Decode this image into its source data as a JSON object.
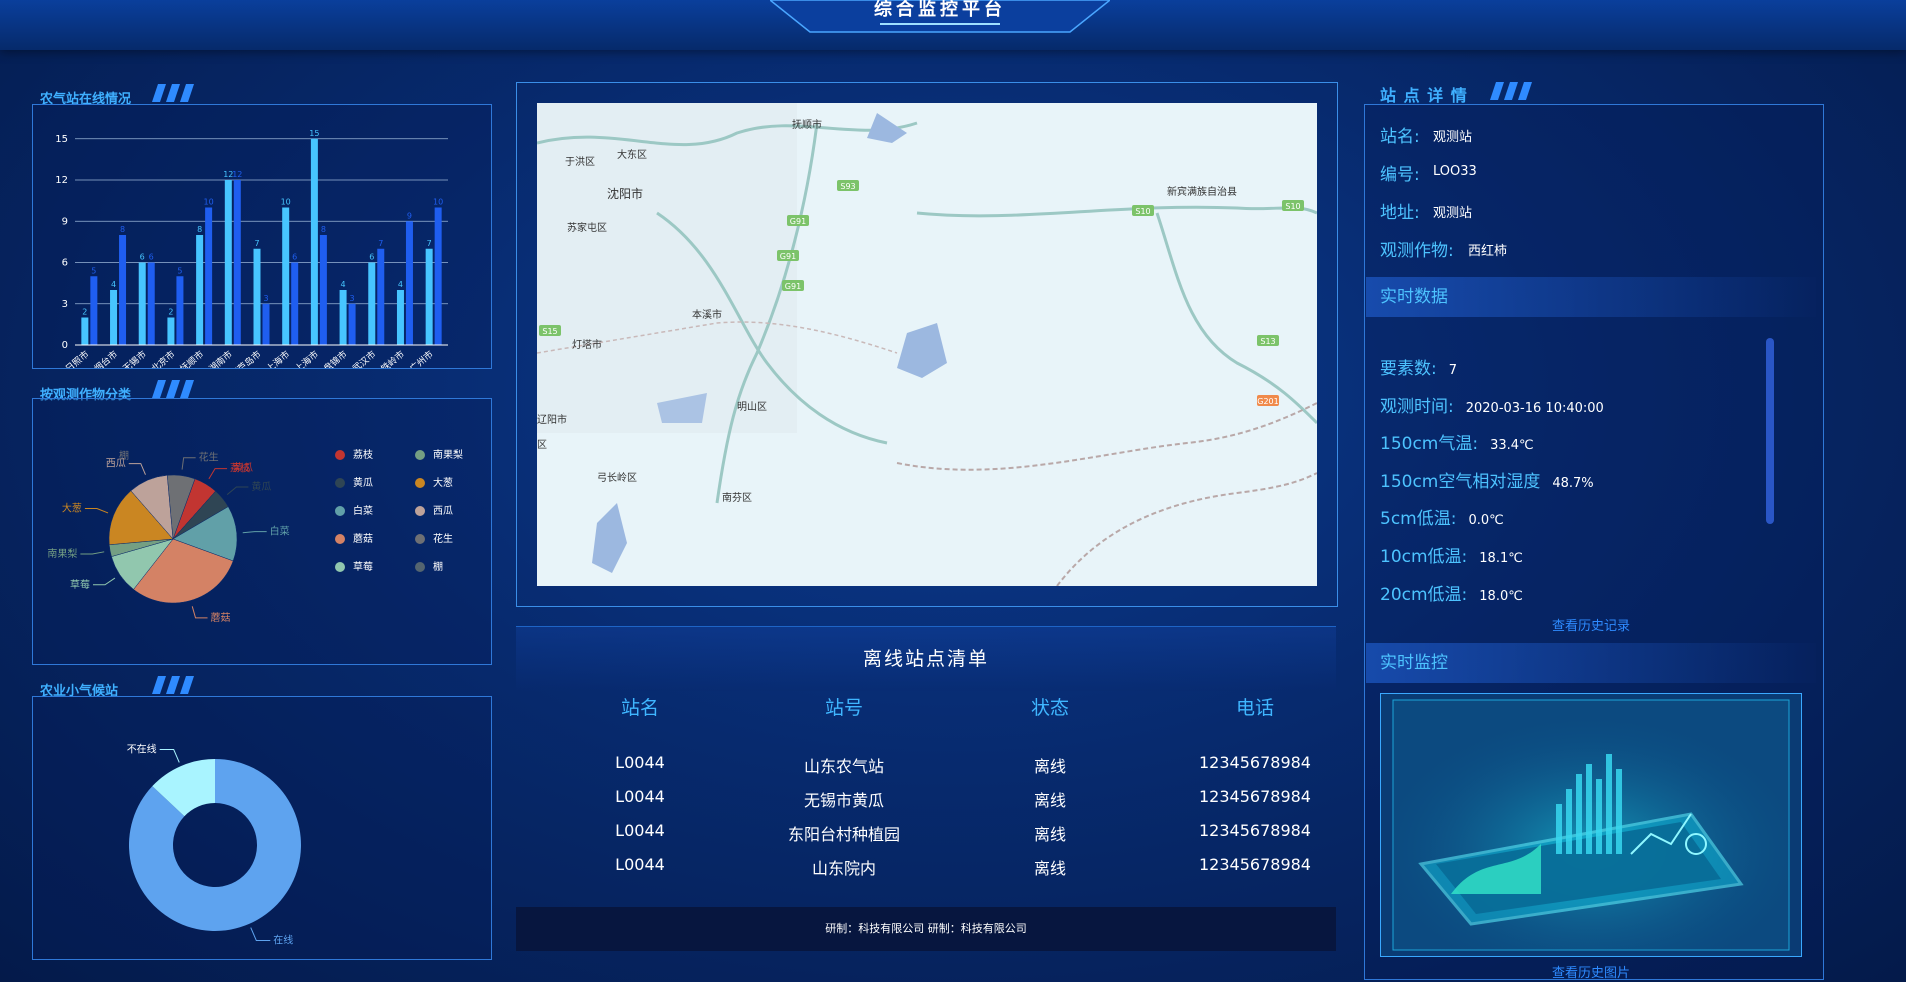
{
  "header": {
    "title": "综合监控平台"
  },
  "panels": {
    "online": {
      "title": "农气站在线情况"
    },
    "crop": {
      "title": "按观测作物分类"
    },
    "station": {
      "title": "农业小气候站"
    },
    "detail": {
      "title": "站 点 详 情"
    }
  },
  "chart_data": [
    {
      "type": "bar",
      "title": "农气站在线情况",
      "categories": [
        "日照市",
        "烟台市",
        "无锡市",
        "北京市",
        "抚顺市",
        "湖南市",
        "葫芦岛市",
        "上海市",
        "上海市",
        "盘锦市",
        "武汉市",
        "铁岭市",
        "广州市"
      ],
      "y_ticks": [
        "0",
        "3",
        "6",
        "9",
        "12",
        "15"
      ],
      "ylim": [
        0,
        16
      ],
      "series": [
        {
          "values": [
            2,
            4,
            6,
            2,
            8,
            12,
            7,
            10,
            15,
            4,
            6,
            4,
            7
          ],
          "color": "#47c5ff"
        },
        {
          "values": [
            5,
            8,
            6,
            5,
            10,
            12,
            3,
            6,
            8,
            3,
            7,
            9,
            10
          ],
          "color": "#1f5ef0"
        }
      ],
      "grid": true
    },
    {
      "type": "pie",
      "title": "按观测作物分类",
      "slices": [
        {
          "name": "荔枝",
          "value": 6,
          "color": "#c23531"
        },
        {
          "name": "黄瓜",
          "value": 5,
          "color": "#2f4554"
        },
        {
          "name": "白菜",
          "value": 14,
          "color": "#61a0a8"
        },
        {
          "name": "蘑菇",
          "value": 30,
          "color": "#d48265"
        },
        {
          "name": "草莓",
          "value": 10,
          "color": "#91c7ae"
        },
        {
          "name": "南果梨",
          "value": 3,
          "color": "#749f83"
        },
        {
          "name": "大葱",
          "value": 15,
          "color": "#ca8622"
        },
        {
          "name": "西瓜",
          "value": 10,
          "color": "#bda29a"
        },
        {
          "name": "花生",
          "value": 7,
          "color": "#6e7074"
        }
      ],
      "legend": [
        {
          "name": "荔枝",
          "color": "#c23531"
        },
        {
          "name": "南果梨",
          "color": "#749f83"
        },
        {
          "name": "黄瓜",
          "color": "#2f4554"
        },
        {
          "name": "大葱",
          "color": "#ca8622"
        },
        {
          "name": "白菜",
          "color": "#61a0a8"
        },
        {
          "name": "西瓜",
          "color": "#bda29a"
        },
        {
          "name": "蘑菇",
          "color": "#d48265"
        },
        {
          "name": "花生",
          "color": "#6e7074"
        },
        {
          "name": "草莓",
          "color": "#91c7ae"
        },
        {
          "name": "棚",
          "color": "#546570"
        }
      ],
      "extra_labels": [
        "棚",
        "黄瓜"
      ],
      "legend_position": "right"
    },
    {
      "type": "pie",
      "title": "农业小气候站",
      "donut": true,
      "slices": [
        {
          "name": "在线",
          "value": 87,
          "color": "#5ea3ef"
        },
        {
          "name": "不在线",
          "value": 13,
          "color": "#a9f4ff"
        }
      ]
    }
  ],
  "map": {
    "labels": [
      "抚顺市",
      "大东区",
      "于洪区",
      "沈阳市",
      "苏家屯区",
      "本溪市",
      "灯塔市",
      "明山区",
      "辽阳市",
      "弓长岭区",
      "南芬区",
      "新宾满族自治县",
      "区"
    ],
    "road_badges": [
      "S93",
      "G91",
      "G91",
      "G91",
      "S10",
      "S10",
      "S13",
      "G201",
      "S15"
    ]
  },
  "offline": {
    "title": "离线站点清单",
    "headers": [
      "站名",
      "站号",
      "状态",
      "电话"
    ],
    "rows": [
      [
        "L0044",
        "山东农气站",
        "离线",
        "12345678984"
      ],
      [
        "L0044",
        "无锡市黄瓜",
        "离线",
        "12345678984"
      ],
      [
        "L0044",
        "东阳台村种植园",
        "离线",
        "12345678984"
      ],
      [
        "L0044",
        "山东院内",
        "离线",
        "12345678984"
      ]
    ],
    "footer": "研制：科技有限公司   研制：科技有限公司"
  },
  "detail": {
    "name_label": "站名:",
    "name": "观测站",
    "id_label": "编号:",
    "id": "LOO33",
    "addr_label": "地址:",
    "addr": "观测站",
    "crop_label": "观测作物:",
    "crop": "西红柿"
  },
  "realtime": {
    "title": "实时数据",
    "items": [
      {
        "label": "要素数:",
        "value": "7"
      },
      {
        "label": "观测时间:",
        "value": "2020-03-16 10:40:00"
      },
      {
        "label": "150cm气温:",
        "value": "33.4℃"
      },
      {
        "label": "150cm空气相对湿度",
        "value": "48.7%"
      },
      {
        "label": "5cm低温:",
        "value": "0.0℃"
      },
      {
        "label": "10cm低温:",
        "value": "18.1℃"
      },
      {
        "label": "20cm低温:",
        "value": "18.0℃"
      }
    ],
    "history_link": "查看历史记录"
  },
  "monitor": {
    "title": "实时监控",
    "history_link": "查看历史图片"
  }
}
